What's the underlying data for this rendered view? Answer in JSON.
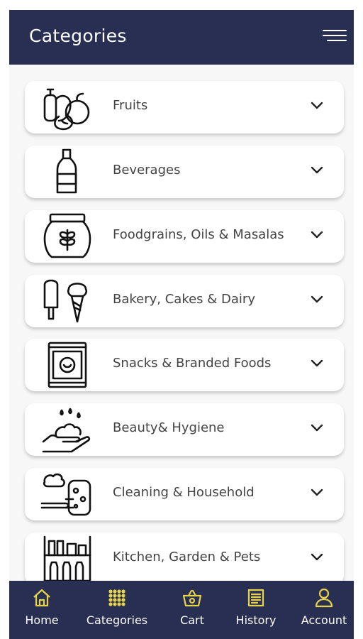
{
  "header": {
    "title": "Categories",
    "menu_icon": "hamburger-menu-icon"
  },
  "categories": [
    {
      "label": "Fruits",
      "icon": "fruits-icon"
    },
    {
      "label": "Beverages",
      "icon": "bottle-icon"
    },
    {
      "label": "Foodgrains, Oils & Masalas",
      "icon": "grain-jar-icon"
    },
    {
      "label": "Bakery, Cakes & Dairy",
      "icon": "ice-cream-icon"
    },
    {
      "label": "Snacks & Branded Foods",
      "icon": "snack-bag-icon"
    },
    {
      "label": "Beauty& Hygiene",
      "icon": "soap-hand-icon"
    },
    {
      "label": "Cleaning & Household",
      "icon": "sponge-hand-icon"
    },
    {
      "label": "Kitchen, Garden & Pets",
      "icon": "shelf-icon"
    }
  ],
  "bottom_nav": [
    {
      "label": "Home",
      "icon": "home-icon"
    },
    {
      "label": "Categories",
      "icon": "grid-dots-icon"
    },
    {
      "label": "Cart",
      "icon": "basket-icon"
    },
    {
      "label": "History",
      "icon": "history-document-icon"
    },
    {
      "label": "Account",
      "icon": "user-icon"
    }
  ],
  "colors": {
    "primary": "#282f52",
    "nav_icon": "#e6d34a",
    "background": "#f7f7f7"
  }
}
